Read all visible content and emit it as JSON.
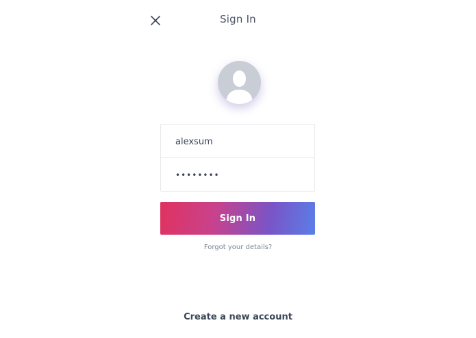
{
  "header": {
    "title": "Sign In",
    "close_icon": "close-icon"
  },
  "avatar": {
    "icon": "user-silhouette-icon"
  },
  "form": {
    "username_value": "alexsum",
    "password_value": "••••••••"
  },
  "actions": {
    "signin_label": "Sign In",
    "forgot_label": "Forgot your details?",
    "create_account_label": "Create a new account"
  },
  "colors": {
    "gradient_start": "#e0325f",
    "gradient_end": "#5a7ee8",
    "text": "#3b4556",
    "avatar_bg": "#c9ced6"
  }
}
